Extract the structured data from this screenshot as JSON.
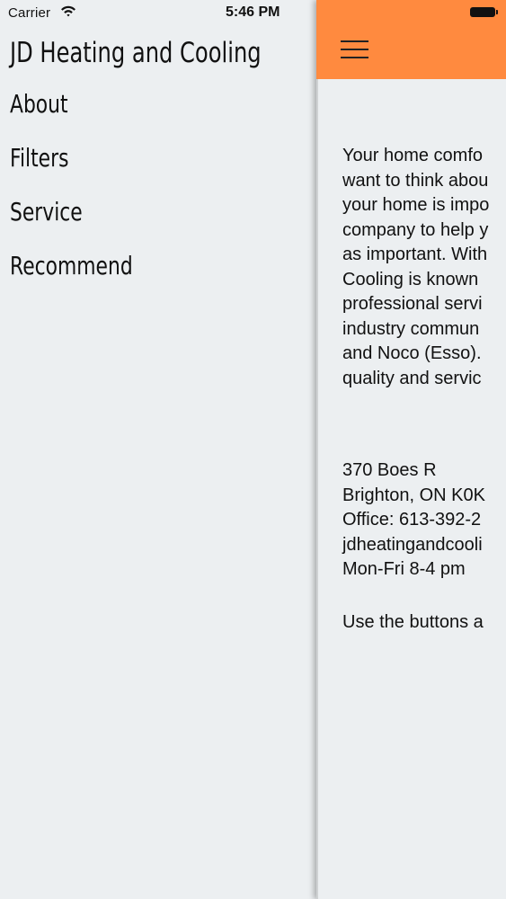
{
  "status_bar": {
    "carrier": "Carrier",
    "wifi_icon": "wifi-icon",
    "time": "5:46 PM",
    "battery_icon": "battery-icon"
  },
  "drawer": {
    "title": "JD Heating and Cooling",
    "items": [
      {
        "label": "About"
      },
      {
        "label": "Filters"
      },
      {
        "label": "Service"
      },
      {
        "label": "Recommend"
      }
    ]
  },
  "nav_bar": {
    "color": "#ff8a3f",
    "menu_icon": "hamburger-menu-icon"
  },
  "content": {
    "paragraph_lines": [
      "Your home comfo",
      "want to think abou",
      "your home is impo",
      "company to help y",
      "as important. With",
      "Cooling is known",
      "professional servi",
      "industry commun",
      "and Noco (Esso).",
      "quality and servic"
    ],
    "contact_lines": [
      "370 Boes R",
      "Brighton, ON K0K",
      "Office: 613-392-2",
      "jdheatingandcooli",
      "Mon-Fri 8-4 pm"
    ],
    "footer_line": "Use the buttons a"
  }
}
